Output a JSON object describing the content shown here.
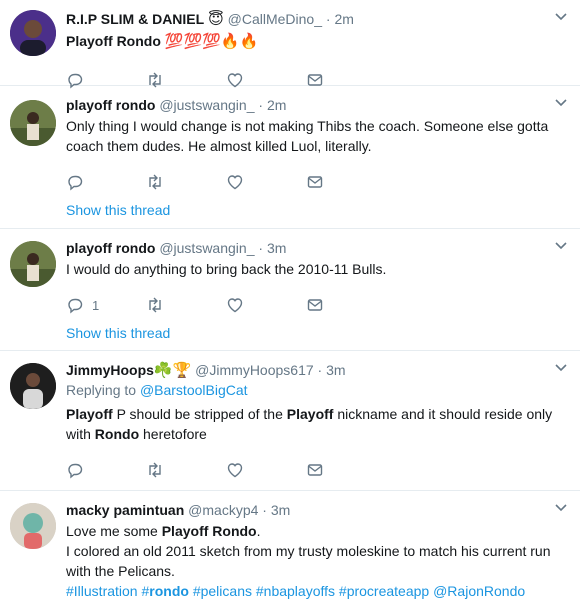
{
  "tweets": [
    {
      "name": "R.I.P SLIM & DANIEL",
      "badge": "😇",
      "handle": "@CallMeDino_",
      "time": "2m",
      "text_bold": "Playoff Rondo",
      "text_emoji": "💯💯💯🔥🔥",
      "avatar_color": "#3a2a6e"
    },
    {
      "name": "playoff rondo",
      "handle": "@justswangin_",
      "time": "2m",
      "text": "Only thing I would change is not making Thibs the coach. Someone else gotta coach them dudes. He almost killed Luol, literally.",
      "show_thread": "Show this thread",
      "avatar_color": "#5a6a3a"
    },
    {
      "name": "playoff rondo",
      "handle": "@justswangin_",
      "time": "3m",
      "text": "I would do anything to bring back the 2010-11 Bulls.",
      "reply_count": "1",
      "show_thread": "Show this thread",
      "avatar_color": "#5a6a3a"
    },
    {
      "name": "JimmyHoops",
      "badge": "☘️🏆",
      "handle": "@JimmyHoops617",
      "time": "3m",
      "replying_prefix": "Replying to ",
      "replying_to": "@BarstoolBigCat",
      "t1": "Playoff",
      "t2": " P should be stripped of the ",
      "t3": "Playoff",
      "t4": " nickname and it should reside only",
      "t5": "with ",
      "t6": "Rondo",
      "t7": " heretofore",
      "avatar_color": "#2b2b2b"
    },
    {
      "name": "macky pamintuan",
      "handle": "@mackyp4",
      "time": "3m",
      "l1a": "Love me some ",
      "l1b": "Playoff Rondo",
      "l1c": ".",
      "l2": "I colored an old 2011 sketch from my trusty moleskine to match his current run",
      "l3": "with the Pelicans.",
      "tags": {
        "h1": "#Illustration",
        "h2a": "#",
        "h2b": "rondo",
        "h3": "#pelicans",
        "h4": "#nbaplayoffs",
        "h5": "#procreateapp",
        "h6": "@RajonRondo"
      },
      "avatar_color": "#c9c2b8"
    }
  ],
  "colors": {
    "link": "#1b95e0",
    "muted": "#657786",
    "divider": "#e6ecf0"
  },
  "icons": [
    "reply-icon",
    "retweet-icon",
    "like-icon",
    "dm-icon",
    "caret-down-icon"
  ]
}
